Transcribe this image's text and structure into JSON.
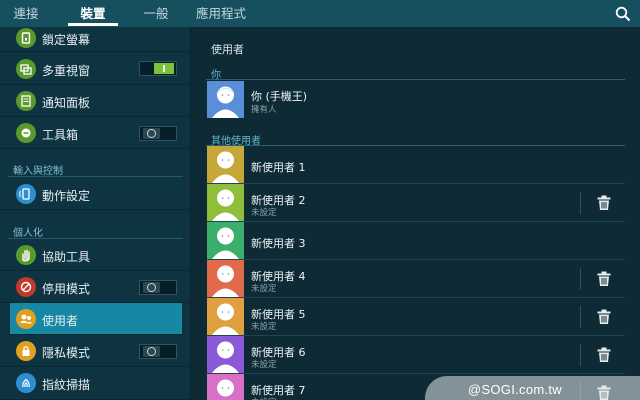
{
  "tabs": [
    {
      "label": "連接",
      "active": false
    },
    {
      "label": "裝置",
      "active": true
    },
    {
      "label": "一般",
      "active": false
    },
    {
      "label": "應用程式",
      "active": false
    }
  ],
  "sidebar": {
    "items": [
      {
        "label": "鎖定螢幕",
        "icon": "lock-screen-icon",
        "color": "#5a9a2c"
      },
      {
        "label": "多重視窗",
        "icon": "multi-window-icon",
        "color": "#5a9a2c",
        "toggle": "on"
      },
      {
        "label": "通知面板",
        "icon": "notification-panel-icon",
        "color": "#5a9a2c"
      },
      {
        "label": "工具箱",
        "icon": "toolbox-icon",
        "color": "#5a9a2c",
        "toggle": "off"
      },
      {
        "label": "動作設定",
        "icon": "motion-icon",
        "color": "#2c8fcf"
      },
      {
        "label": "協助工具",
        "icon": "accessibility-hand-icon",
        "color": "#5a9a2c"
      },
      {
        "label": "停用模式",
        "icon": "blocking-mode-icon",
        "color": "#c0392b",
        "toggle": "off"
      },
      {
        "label": "使用者",
        "icon": "users-icon",
        "color": "#e0a020",
        "selected": true
      },
      {
        "label": "隱私模式",
        "icon": "private-mode-icon",
        "color": "#e0a020",
        "toggle": "off"
      },
      {
        "label": "指紋掃描",
        "icon": "fingerprint-icon",
        "color": "#2c8fcf"
      }
    ],
    "sections": {
      "input": "輸入與控制",
      "personal": "個人化"
    }
  },
  "main": {
    "title": "使用者",
    "you_header": "你",
    "others_header": "其他使用者",
    "owner": {
      "name": "你 (手機王)",
      "sub": "擁有人",
      "color": "#5b8ed8"
    },
    "users": [
      {
        "name": "新使用者 1",
        "sub": "",
        "color": "#c6a83a",
        "deletable": false
      },
      {
        "name": "新使用者 2",
        "sub": "未設定",
        "color": "#8fbf3a",
        "deletable": true
      },
      {
        "name": "新使用者 3",
        "sub": "",
        "color": "#3aae6a",
        "deletable": false
      },
      {
        "name": "新使用者 4",
        "sub": "未設定",
        "color": "#e06a4a",
        "deletable": true
      },
      {
        "name": "新使用者 5",
        "sub": "未設定",
        "color": "#e0a040",
        "deletable": true
      },
      {
        "name": "新使用者 6",
        "sub": "未設定",
        "color": "#8a5ad8",
        "deletable": true
      },
      {
        "name": "新使用者 7",
        "sub": "未設定",
        "color": "#d870c8",
        "deletable": true
      }
    ]
  },
  "watermark": "@SOGI.com.tw"
}
